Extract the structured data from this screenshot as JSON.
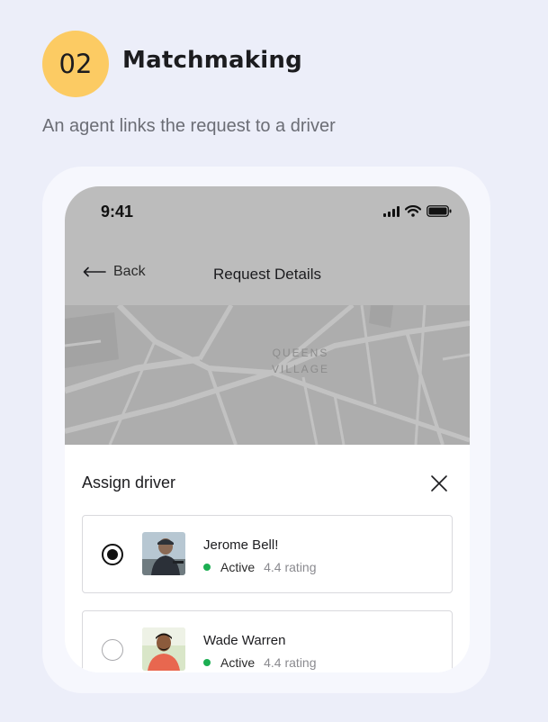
{
  "step": {
    "number": "02",
    "title": "Matchmaking",
    "subtitle": "An agent links the request to a driver"
  },
  "colors": {
    "badge": "#fccb63",
    "background": "#eceef9",
    "active": "#1cae52"
  },
  "status_bar": {
    "time": "9:41",
    "icons": [
      "signal-icon",
      "wifi-icon",
      "battery-icon"
    ]
  },
  "nav": {
    "back_label": "Back",
    "title": "Request Details"
  },
  "map": {
    "label_line1": "QUEENS",
    "label_line2": "VILLAGE"
  },
  "sheet": {
    "title": "Assign driver"
  },
  "drivers": [
    {
      "name": "Jerome Bell!",
      "status": "Active",
      "rating": "4.4 rating",
      "selected": true
    },
    {
      "name": "Wade Warren",
      "status": "Active",
      "rating": "4.4 rating",
      "selected": false
    }
  ]
}
